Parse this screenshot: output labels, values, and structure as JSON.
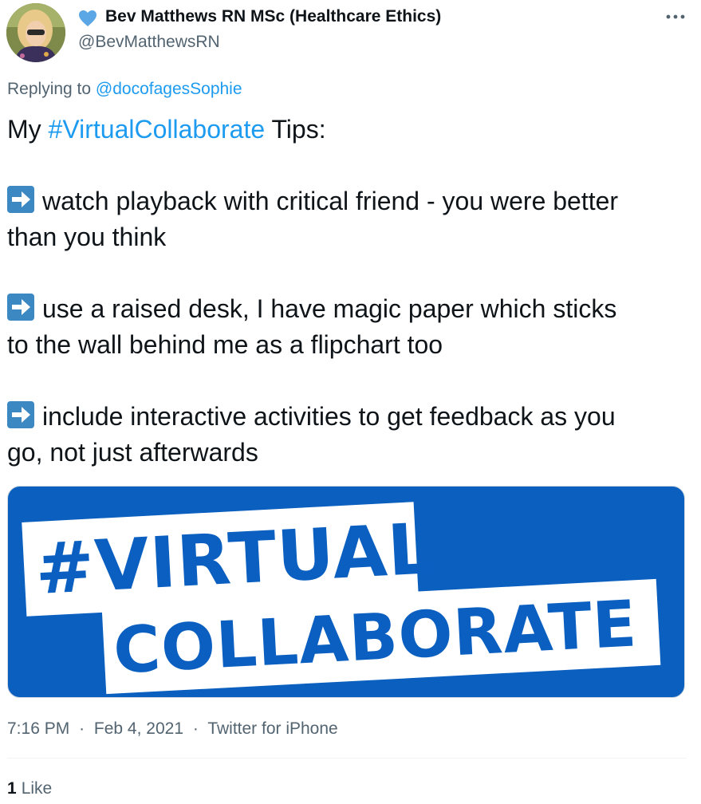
{
  "colors": {
    "link": "#1d9bf0",
    "muted": "#536471",
    "text": "#0f1419",
    "heart": "#5ba7e6",
    "arrow": "#3b88c3",
    "banner_blue": "#0b5fbf"
  },
  "author": {
    "display_name": "Bev Matthews RN MSc (Healthcare Ethics)",
    "handle": "@BevMatthewsRN",
    "name_icon": "blue-heart-icon",
    "avatar_icon": "profile-photo"
  },
  "reply": {
    "prefix": "Replying to",
    "mention": "@docofagesSophie"
  },
  "tweet": {
    "intro_prefix": "My",
    "intro_hashtag": "#VirtualCollaborate",
    "intro_suffix": "Tips:",
    "bullet_icon": "right-arrow-emoji",
    "tip1_line1": "watch playback with critical friend - you were better",
    "tip1_line2": "than you think",
    "tip2_line1": "use a raised desk, I have magic paper which sticks",
    "tip2_line2": "to the wall behind me as a flipchart too",
    "tip3_line1": "include interactive activities to get feedback as you",
    "tip3_line2": "go, not just afterwards"
  },
  "media": {
    "line1": "#VIRTUAL",
    "line2": "COLLABORATE"
  },
  "meta": {
    "time": "7:16 PM",
    "date": "Feb 4, 2021",
    "source": "Twitter for iPhone",
    "separator": "·"
  },
  "stats": {
    "likes_count": "1",
    "likes_label": "Like"
  }
}
